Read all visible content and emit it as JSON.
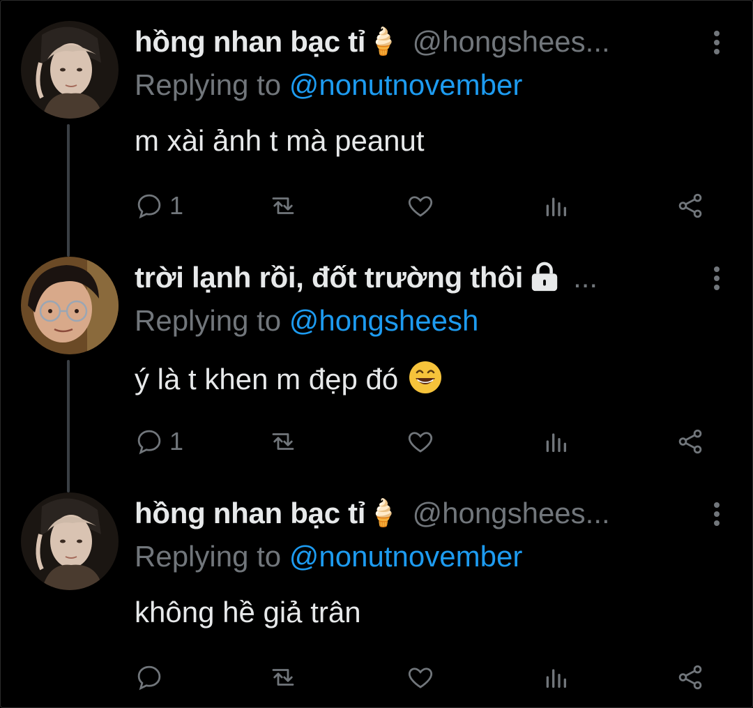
{
  "tweets": [
    {
      "display_name": "hồng nhan bạc tỉ",
      "name_suffix": "🍦",
      "handle": "@hongshees...",
      "replying_label": "Replying to ",
      "replying_to": "@nonutnovember",
      "text": "m xài ảnh t mà peanut",
      "reply_count": "1",
      "avatar_icon": "avatar-photo",
      "locked": false,
      "emoji": ""
    },
    {
      "display_name": "trời lạnh rồi, đốt trường thôi",
      "name_suffix": "",
      "handle": "...",
      "replying_label": "Replying to ",
      "replying_to": "@hongsheesh",
      "text": "ý là t khen m đẹp đó",
      "reply_count": "1",
      "avatar_icon": "avatar-photo",
      "locked": true,
      "emoji": "grinning-face-icon"
    },
    {
      "display_name": "hồng nhan bạc tỉ",
      "name_suffix": "🍦",
      "handle": "@hongshees...",
      "replying_label": "Replying to ",
      "replying_to": "@nonutnovember",
      "text": "không hề giả trân",
      "reply_count": "",
      "avatar_icon": "avatar-photo",
      "locked": false,
      "emoji": ""
    }
  ],
  "colors": {
    "background": "#000000",
    "primary_text": "#e7e9ea",
    "secondary_text": "#71767b",
    "accent": "#1d9bf0",
    "thread_line": "#3a3f44"
  }
}
